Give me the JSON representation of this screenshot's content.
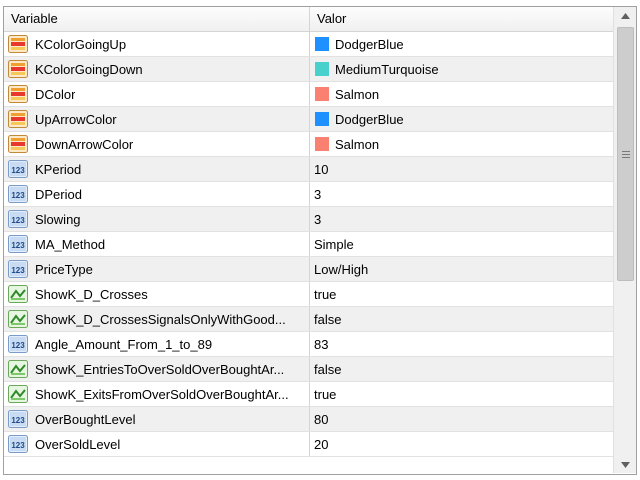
{
  "header": {
    "variable_label": "Variable",
    "value_label": "Valor"
  },
  "rows": [
    {
      "icon": "color-icon",
      "name": "KColorGoingUp",
      "value": "DodgerBlue",
      "swatch": "#1e90ff"
    },
    {
      "icon": "color-icon",
      "name": "KColorGoingDown",
      "value": "MediumTurquoise",
      "swatch": "#48d1cc"
    },
    {
      "icon": "color-icon",
      "name": "DColor",
      "value": "Salmon",
      "swatch": "#fa8072"
    },
    {
      "icon": "color-icon",
      "name": "UpArrowColor",
      "value": "DodgerBlue",
      "swatch": "#1e90ff"
    },
    {
      "icon": "color-icon",
      "name": "DownArrowColor",
      "value": "Salmon",
      "swatch": "#fa8072"
    },
    {
      "icon": "number-icon",
      "name": "KPeriod",
      "value": "10"
    },
    {
      "icon": "number-icon",
      "name": "DPeriod",
      "value": "3"
    },
    {
      "icon": "number-icon",
      "name": "Slowing",
      "value": "3"
    },
    {
      "icon": "number-icon",
      "name": "MA_Method",
      "value": "Simple"
    },
    {
      "icon": "number-icon",
      "name": "PriceType",
      "value": "Low/High"
    },
    {
      "icon": "boolean-icon",
      "name": "ShowK_D_Crosses",
      "value": "true"
    },
    {
      "icon": "boolean-icon",
      "name": "ShowK_D_CrossesSignalsOnlyWithGood...",
      "value": "false"
    },
    {
      "icon": "number-icon",
      "name": "Angle_Amount_From_1_to_89",
      "value": "83"
    },
    {
      "icon": "boolean-icon",
      "name": "ShowK_EntriesToOverSoldOverBoughtAr...",
      "value": "false"
    },
    {
      "icon": "boolean-icon",
      "name": "ShowK_ExitsFromOverSoldOverBoughtAr...",
      "value": "true"
    },
    {
      "icon": "number-icon",
      "name": "OverBoughtLevel",
      "value": "80"
    },
    {
      "icon": "number-icon",
      "name": "OverSoldLevel",
      "value": "20"
    }
  ],
  "colors": {
    "row_alt": "#f0f0f0",
    "grid_border": "#a0a0a0"
  }
}
